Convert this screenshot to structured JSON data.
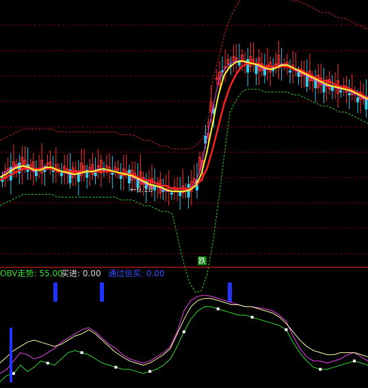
{
  "indicator": {
    "obv_label": "OBV走势: 55.00",
    "buy_label": "买进: 0.00",
    "pass_label": "通过信买: 0.00"
  },
  "price_panel": {
    "low_tag": "←6.18",
    "signal_tag": "跌"
  },
  "colors": {
    "background": "#000000",
    "grid": "#7a0000",
    "divider": "#ff2222",
    "up_candle": "#ff3333",
    "down_candle": "#33ccee",
    "ma_fast": "#ffff33",
    "ma_slow": "#ff2222",
    "ma_magenta": "#ee44ee",
    "band_upper": "#cc2222",
    "band_lower": "#33cc33",
    "obv_line": "#33dd33",
    "signal_bar": "#2233ff"
  },
  "chart_data": [
    {
      "type": "line",
      "title": "",
      "series": [
        {
          "values": [
            10,
            12,
            13,
            14,
            14,
            13,
            12,
            13,
            14,
            13,
            12,
            12,
            11,
            11,
            12,
            12,
            12,
            13,
            13,
            12,
            12,
            11,
            11,
            10,
            9,
            8,
            7,
            7,
            6,
            5,
            5,
            5,
            5,
            6,
            8,
            14,
            24,
            34,
            44,
            48,
            50,
            51,
            51,
            50,
            50,
            49,
            48,
            48,
            49,
            50,
            49,
            48,
            47,
            46,
            45,
            44,
            43,
            42,
            42,
            41,
            41,
            40,
            39,
            38,
            37
          ]
        },
        {
          "values": [
            9,
            10,
            11,
            12,
            13,
            13,
            13,
            13,
            13,
            13,
            12,
            12,
            12,
            12,
            12,
            12,
            12,
            12,
            12,
            12,
            12,
            11,
            11,
            11,
            10,
            9,
            9,
            8,
            7,
            7,
            6,
            6,
            6,
            6,
            7,
            9,
            13,
            20,
            28,
            36,
            42,
            46,
            49,
            50,
            50,
            50,
            49,
            49,
            49,
            49,
            49,
            48,
            48,
            47,
            46,
            45,
            44,
            44,
            43,
            42,
            42,
            41,
            40,
            39,
            38
          ]
        }
      ]
    },
    {
      "type": "line",
      "title": "",
      "series": [
        {
          "values": [
            10,
            14,
            22,
            30,
            28,
            24,
            26,
            30,
            34,
            40,
            44,
            48,
            52,
            54,
            50,
            44,
            38,
            34,
            28,
            24,
            22,
            20,
            22,
            26,
            30,
            36,
            50,
            70,
            80,
            84,
            85,
            84,
            82,
            80,
            78,
            76,
            74,
            74,
            73,
            72,
            70,
            66,
            60,
            46,
            34,
            26,
            22,
            22,
            20,
            22,
            24,
            28,
            30,
            26,
            22
          ]
        },
        {
          "values": [
            20,
            26,
            32,
            36,
            40,
            42,
            40,
            38,
            36,
            38,
            42,
            46,
            48,
            52,
            48,
            42,
            36,
            30,
            26,
            22,
            20,
            18,
            20,
            24,
            28,
            34,
            48,
            62,
            74,
            80,
            82,
            82,
            80,
            78,
            76,
            76,
            74,
            74,
            72,
            70,
            68,
            64,
            58,
            50,
            42,
            36,
            32,
            30,
            28,
            28,
            30,
            30,
            30,
            28,
            26
          ]
        },
        {
          "values": [
            2,
            8,
            10,
            18,
            12,
            16,
            22,
            20,
            18,
            24,
            30,
            32,
            30,
            28,
            24,
            20,
            18,
            16,
            14,
            14,
            12,
            10,
            12,
            14,
            18,
            24,
            36,
            50,
            62,
            70,
            74,
            74,
            72,
            70,
            68,
            66,
            66,
            64,
            62,
            60,
            58,
            56,
            52,
            40,
            30,
            22,
            16,
            14,
            14,
            16,
            18,
            20,
            22,
            20,
            18
          ]
        }
      ]
    }
  ]
}
